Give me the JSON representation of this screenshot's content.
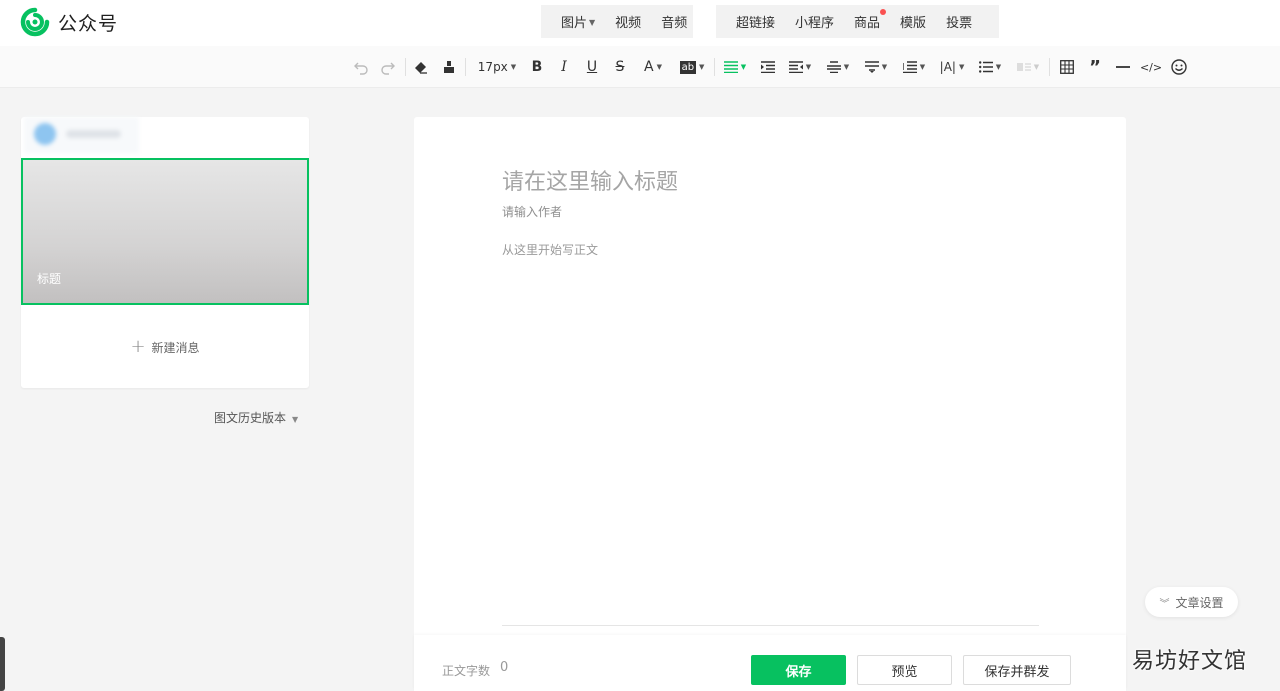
{
  "header": {
    "brand_name": "公众号",
    "insert_group_1": [
      {
        "label": "图片",
        "has_dropdown": true
      },
      {
        "label": "视频",
        "has_dropdown": false
      },
      {
        "label": "音频",
        "has_dropdown": false
      }
    ],
    "insert_group_2": [
      {
        "label": "超链接"
      },
      {
        "label": "小程序"
      },
      {
        "label": "商品",
        "badge": "red-dot"
      },
      {
        "label": "模版"
      },
      {
        "label": "投票"
      }
    ]
  },
  "toolbar": {
    "font_size": "17px",
    "icons": [
      "undo-icon",
      "redo-icon",
      "eraser-icon",
      "format-painter-icon",
      "bold-icon",
      "italic-icon",
      "underline-icon",
      "strikethrough-icon",
      "font-color-icon",
      "background-color-icon",
      "align-icon",
      "indent-icon",
      "outdent-icon",
      "line-height-icon",
      "paragraph-spacing-icon",
      "letter-spacing-icon",
      "text-direction-icon",
      "list-icon",
      "align-disabled-icon",
      "table-icon",
      "quote-icon",
      "divider-icon",
      "code-icon",
      "emoji-icon"
    ],
    "active_color": "#07c160"
  },
  "left_panel": {
    "cover_title": "标题",
    "new_message": "新建消息",
    "history_versions": "图文历史版本"
  },
  "editor": {
    "title_placeholder": "请在这里输入标题",
    "author_placeholder": "请输入作者",
    "body_placeholder": "从这里开始写正文",
    "word_count_label": "正文字数",
    "word_count": "0",
    "save": "保存",
    "preview": "预览",
    "save_and_send": "保存并群发"
  },
  "article_settings": "文章设置",
  "watermark": "易坊好文馆",
  "colors": {
    "brand_green": "#07c160",
    "badge_red": "#fa5151"
  }
}
